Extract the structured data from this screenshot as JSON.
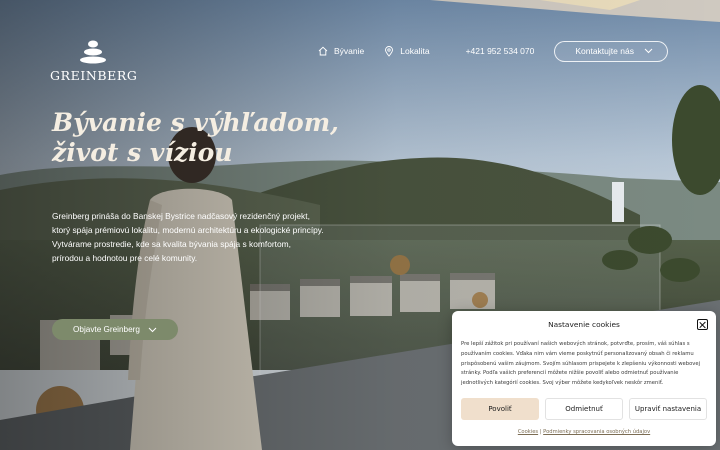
{
  "brand": {
    "name": "GREINBERG"
  },
  "nav": {
    "items": [
      {
        "label": "Bývanie",
        "icon": "home-icon"
      },
      {
        "label": "Lokalita",
        "icon": "map-pin-icon"
      }
    ],
    "phone": "+421 952 534 070",
    "contact_label": "Kontaktujte nás"
  },
  "hero": {
    "headline_line1": "Bývanie s výhľadom,",
    "headline_line2": "život s víziou",
    "intro": "Greinberg prináša do Banskej Bystrice nadčasový rezidenčný projekt, ktorý spája prémiovú lokalitu, modernú architektúru a ekologické princípy. Vytvárame prostredie, kde sa kvalita bývania spája s komfortom, prírodou a hodnotou pre celé komunity.",
    "cta_label": "Objavte Greinberg"
  },
  "cookie": {
    "title": "Nastavenie cookies",
    "body": "Pre lepší zážitok pri používaní našich webových stránok, potvrďte, prosím, váš súhlas s používaním cookies. Vďaka nim vám vieme poskytnúť personalizovaný obsah či reklamu prispôsobenú vašim záujmom. Svojím súhlasom prispejete k zlepšeniu výkonnosti webovej stránky. Podľa vašich preferencií môžete nižšie povoliť alebo odmietnuť používanie jednotlivých kategórií cookies. Svoj výber môžete kedykoľvek neskôr zmeniť.",
    "accept_label": "Povoliť",
    "deny_label": "Odmietnuť",
    "settings_label": "Upraviť nastavenia",
    "link_cookies": "Cookies",
    "link_separator": " | ",
    "link_privacy": "Podmienky spracovania osobných údajov"
  },
  "colors": {
    "accent": "#7d8a6b",
    "accept_button": "#f0dfcc",
    "headline": "#f5eee2"
  }
}
